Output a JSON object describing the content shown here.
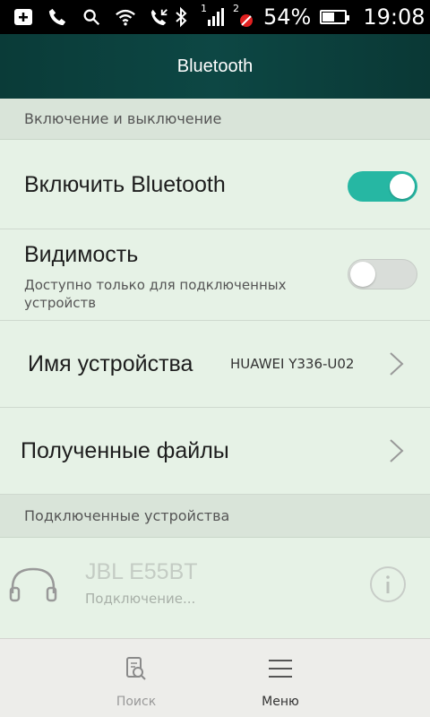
{
  "status_bar": {
    "battery_percent_text": "54%",
    "battery_level": 0.54,
    "time": "19:08",
    "signal_1_label": "1",
    "signal_2_label": "2",
    "icons": [
      "add-box-icon",
      "phone-icon",
      "search-icon",
      "wifi-icon",
      "call-forward-icon",
      "bluetooth-icon",
      "signal-icon",
      "no-sim-icon",
      "battery-icon"
    ]
  },
  "header": {
    "title": "Bluetooth"
  },
  "sections": {
    "power": "Включение и выключение",
    "connected": "Подключенные устройства"
  },
  "rows": {
    "enable_bluetooth": {
      "label": "Включить Bluetooth",
      "state": "on"
    },
    "visibility": {
      "label": "Видимость",
      "subtitle_line1": "Доступно только для подключенных",
      "subtitle_line2": "устройств",
      "state": "off"
    },
    "device_name": {
      "label": "Имя устройства",
      "value": "HUAWEI Y336-U02"
    },
    "received_files": {
      "label": "Полученные файлы"
    }
  },
  "connected_device": {
    "name": "JBL E55BT",
    "status": "Подключение...",
    "icon": "headphones-icon",
    "info_icon": "info-icon"
  },
  "bottom_bar": {
    "search_label": "Поиск",
    "menu_label": "Меню"
  },
  "colors": {
    "accent": "#26b7a3",
    "header_bg": "#0d4744",
    "background": "#e6f2e6"
  }
}
